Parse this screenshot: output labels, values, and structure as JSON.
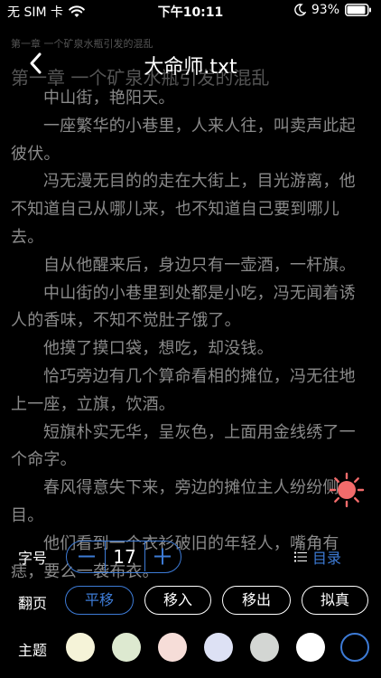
{
  "status_bar": {
    "carrier": "无 SIM 卡",
    "time": "下午10:11",
    "battery_percent": "93%",
    "battery_level": 0.93
  },
  "nav": {
    "title": "大命师.txt"
  },
  "reader": {
    "header_small": "第一章 一个矿泉水瓶引发的混乱",
    "chapter_title": "第一章 一个矿泉水瓶引发的混乱",
    "paragraphs": [
      "中山街，艳阳天。",
      "一座繁华的小巷里，人来人往，叫卖声此起彼伏。",
      "冯无漫无目的的走在大街上，目光游离，他不知道自己从哪儿来，也不知道自己要到哪儿去。",
      "自从他醒来后，身边只有一壶酒，一杆旗。",
      "中山街的小巷里到处都是小吃，冯无闻着诱人的香味，不知不觉肚子饿了。",
      "他摸了摸口袋，想吃，却没钱。",
      "恰巧旁边有几个算命看相的摊位，冯无往地上一座，立旗，饮酒。",
      "短旗朴实无华，呈灰色，上面用金线绣了一个命字。",
      "春风得意失下来，旁边的摊位主人纷纷侧目。",
      "他们看到一个衣衫破旧的年轻人，嘴角有痣，要么一袭布衣。"
    ]
  },
  "panel": {
    "font_size_label": "字号",
    "font_size_value": "17",
    "toc_label": "目录",
    "page_turn_label": "翻页",
    "page_turn_modes": [
      "平移",
      "移入",
      "移出",
      "拟真"
    ],
    "page_turn_selected": "平移",
    "theme_label": "主题",
    "themes": [
      "#f5f3d8",
      "#dde9d0",
      "#f6ddd8",
      "#dde1f4",
      "#d3d6d3",
      "#ffffff",
      "#000000"
    ],
    "theme_selected_index": 6
  },
  "colors": {
    "accent": "#3d7bd6",
    "sun": "#f26b6b"
  }
}
